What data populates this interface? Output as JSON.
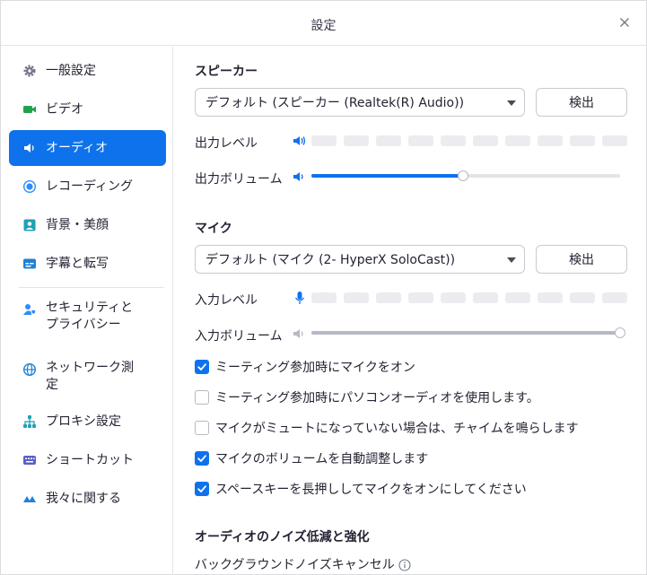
{
  "window": {
    "title": "設定"
  },
  "sidebar": {
    "items": [
      {
        "label": "一般設定",
        "icon": "gear-icon"
      },
      {
        "label": "ビデオ",
        "icon": "video-camera-icon"
      },
      {
        "label": "オーディオ",
        "icon": "speaker-icon",
        "active": true
      },
      {
        "label": "レコーディング",
        "icon": "record-icon"
      },
      {
        "label": "背景・美顔",
        "icon": "background-portrait-icon"
      },
      {
        "label": "字幕と転写",
        "icon": "captions-icon"
      },
      {
        "label": "セキュリティと\nプライバシー",
        "icon": "security-shield-icon"
      },
      {
        "label": "ネットワーク測\n定",
        "icon": "globe-icon"
      },
      {
        "label": "プロキシ設定",
        "icon": "proxy-network-icon"
      },
      {
        "label": "ショートカット",
        "icon": "keyboard-icon"
      },
      {
        "label": "我々に関する",
        "icon": "logo-icon"
      }
    ]
  },
  "speaker": {
    "section_title": "スピーカー",
    "device": "デフォルト (スピーカー (Realtek(R) Audio))",
    "detect_label": "検出",
    "level_label": "出力レベル",
    "volume_label": "出力ボリューム",
    "volume_percent": 49,
    "level_segments": 10,
    "level_active": 0
  },
  "mic": {
    "section_title": "マイク",
    "device": "デフォルト (マイク (2- HyperX SoloCast))",
    "detect_label": "検出",
    "level_label": "入力レベル",
    "volume_label": "入力ボリューム",
    "volume_percent": 100,
    "level_segments": 10,
    "level_active": 0
  },
  "options": [
    {
      "label": "ミーティング参加時にマイクをオン",
      "checked": true
    },
    {
      "label": "ミーティング参加時にパソコンオーディオを使用します。",
      "checked": false
    },
    {
      "label": "マイクがミュートになっていない場合は、チャイムを鳴らします",
      "checked": false
    },
    {
      "label": "マイクのボリュームを自動調整します",
      "checked": true
    },
    {
      "label": "スペースキーを長押ししてマイクをオンにしてください",
      "checked": true
    }
  ],
  "noise": {
    "section_title": "オーディオのノイズ低減と強化",
    "bg_noise_label": "バックグラウンドノイズキャンセル"
  },
  "colors": {
    "accent": "#0e72ed",
    "text": "#232333",
    "meter_idle": "#ececf0",
    "slider_disabled": "#b6b8c4"
  }
}
